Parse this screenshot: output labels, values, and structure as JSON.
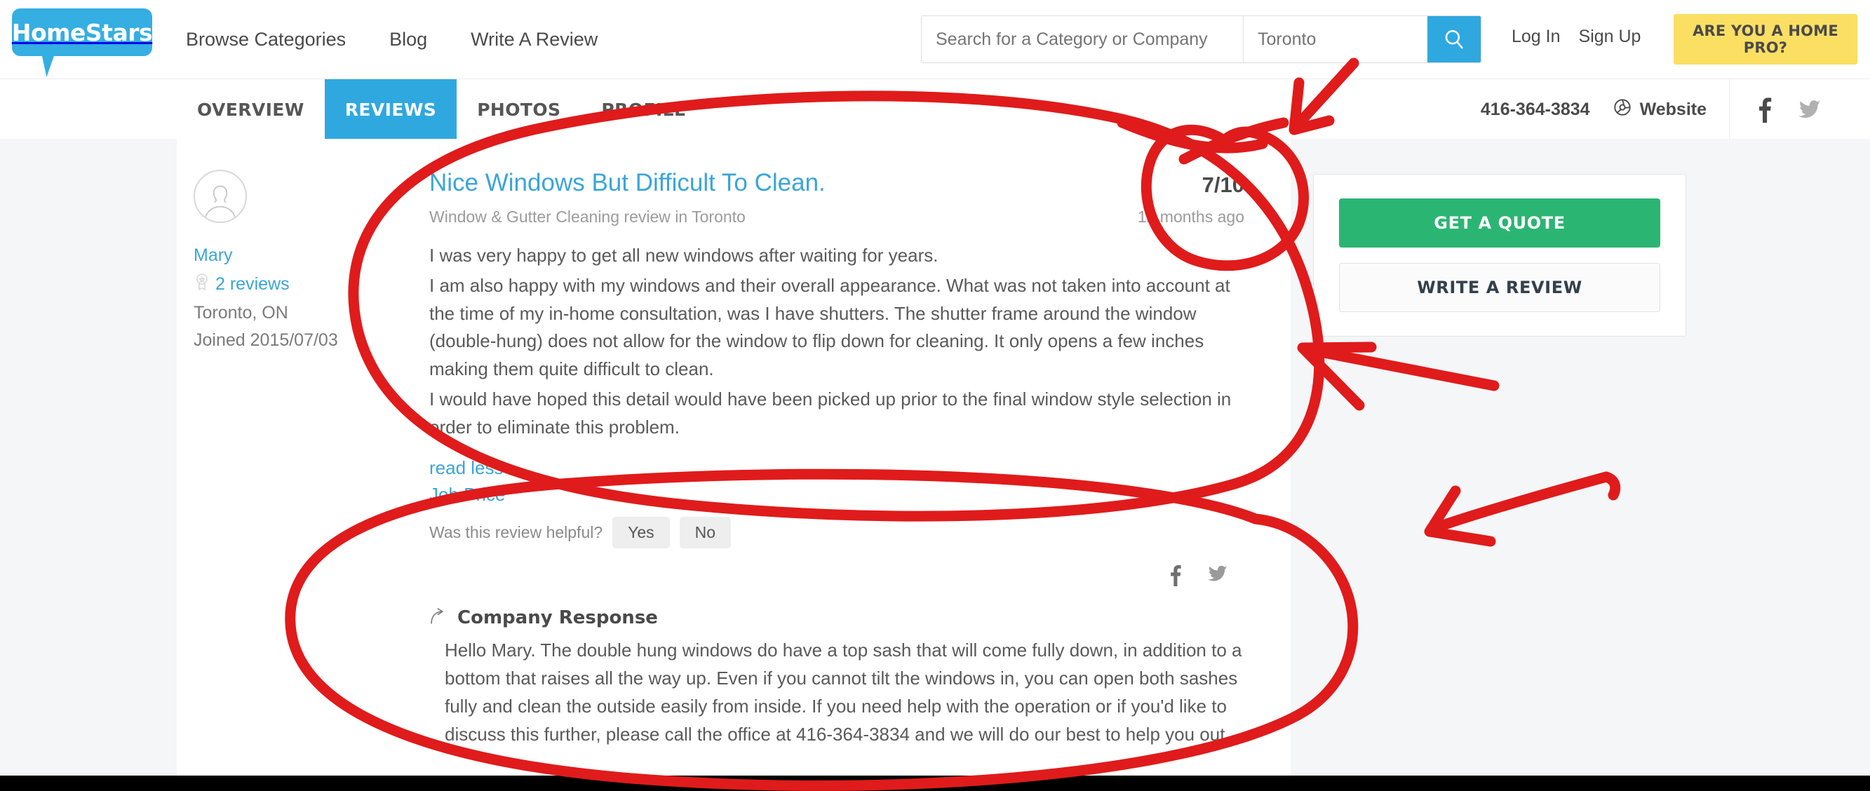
{
  "header": {
    "logo_text": "HomeStars",
    "nav": [
      {
        "label": "Browse Categories"
      },
      {
        "label": "Blog"
      },
      {
        "label": "Write A Review"
      }
    ],
    "search": {
      "category_placeholder": "Search for a Category or Company",
      "category_value": "",
      "location_placeholder": "Toronto",
      "location_value": "",
      "search_icon": "search-icon"
    },
    "login_label": "Log In",
    "signup_label": "Sign Up",
    "home_pro_label": "ARE YOU A HOME PRO?"
  },
  "subnav": {
    "tabs": [
      {
        "label": "OVERVIEW",
        "active": false
      },
      {
        "label": "REVIEWS",
        "active": true
      },
      {
        "label": "PHOTOS",
        "active": false
      },
      {
        "label": "PROFILE",
        "active": false
      }
    ],
    "phone": "416-364-3834",
    "website_label": "Website",
    "website_icon": "globe-icon",
    "facebook_icon": "facebook-icon",
    "twitter_icon": "twitter-icon"
  },
  "review": {
    "reviewer": {
      "avatar_icon": "user-avatar-icon",
      "name": "Mary",
      "reviews_count_label": "2 reviews",
      "badge_icon": "award-badge-icon",
      "location": "Toronto, ON",
      "joined": "Joined 2015/07/03"
    },
    "title": "Nice Windows But Difficult To Clean.",
    "score": "7/10",
    "category_line": "Window & Gutter Cleaning review in Toronto",
    "age": "12 months ago",
    "paragraphs": [
      "I was very happy to get all new windows after waiting for years.",
      "I am also happy with my windows and their overall appearance. What was not taken into account at the time of my in-home consultation, was I have shutters. The shutter frame around the window (double-hung) does not allow for the window to flip down for cleaning. It only opens a few inches making them quite difficult to clean.",
      "I would have hoped this detail would have been picked up prior to the final window style selection in order to eliminate this problem."
    ],
    "read_less_label": "read less",
    "job_price_label": "Job Price",
    "helpful_label": "Was this review helpful?",
    "helpful_yes": "Yes",
    "helpful_no": "No",
    "share_facebook_icon": "facebook-icon",
    "share_twitter_icon": "twitter-icon",
    "company_response": {
      "reply_icon": "reply-arrow-icon",
      "title": "Company Response",
      "text": "Hello Mary. The double hung windows do have a top sash that will come fully down, in addition to a bottom that raises all the way up. Even if you cannot tilt the windows in, you can open both sashes fully and clean the outside easily from inside. If you need help with the operation or if you'd like to discuss this further, please call the office at 416-364-3834 and we will do our best to help you out."
    }
  },
  "sidebar": {
    "get_quote_label": "GET A QUOTE",
    "write_review_label": "WRITE A REVIEW"
  },
  "colors": {
    "brand_blue": "#2fa8e0",
    "link_blue": "#3aa5d8",
    "quote_green": "#2bb573",
    "pro_yellow": "#fadf63",
    "annotation_red": "#e01b1b",
    "page_bg": "#f4f6f8"
  }
}
